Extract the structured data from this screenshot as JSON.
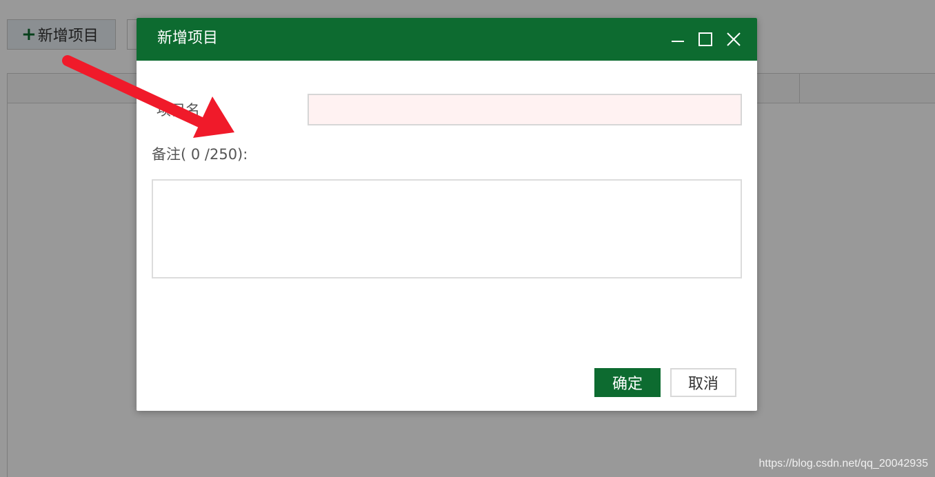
{
  "toolbar": {
    "add_label": "新增项目"
  },
  "dialog": {
    "title": "新增项目",
    "name_label": "项目名",
    "note_label": "备注( 0 /250):",
    "confirm_label": "确定",
    "cancel_label": "取消"
  },
  "watermark": "https://blog.csdn.net/qq_20042935",
  "colors": {
    "brand": "#0d6b30",
    "arrow": "#f01a2a",
    "required": "#d62c2c"
  },
  "icons": {
    "minimize": "minimize-icon",
    "maximize": "maximize-icon",
    "close": "close-icon",
    "plus": "plus-icon"
  }
}
